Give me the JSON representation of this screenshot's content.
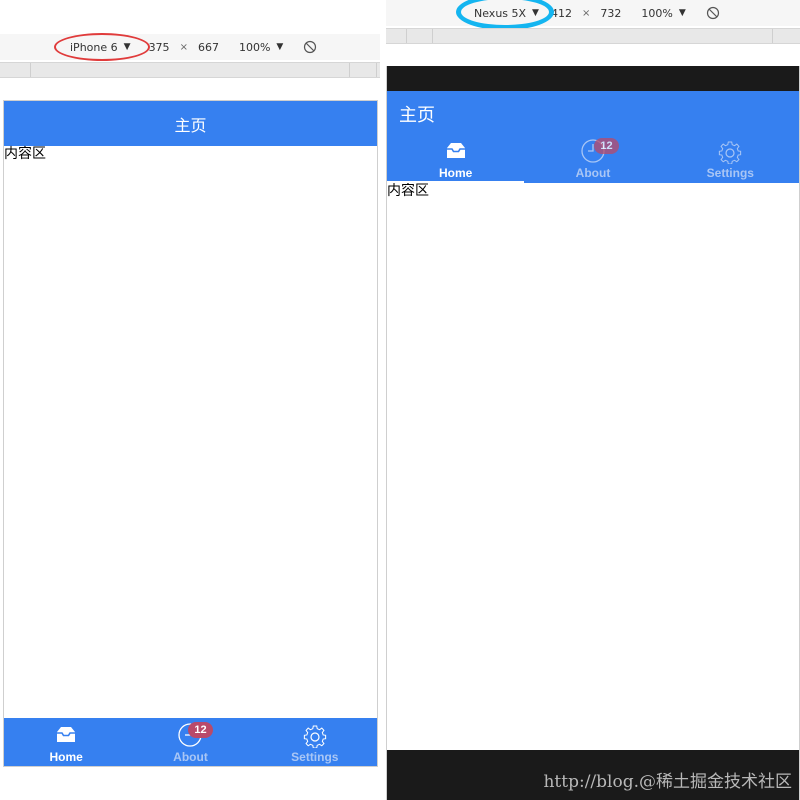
{
  "left_device": {
    "toolbar": {
      "device_name": "iPhone 6",
      "width": "375",
      "times": "×",
      "height": "667",
      "zoom": "100%"
    },
    "header": {
      "title": "主页"
    },
    "content": {
      "text": "内容区"
    },
    "tabs": [
      {
        "label": "Home",
        "icon": "inbox-icon",
        "active": true
      },
      {
        "label": "About",
        "icon": "clock-icon",
        "active": false,
        "badge": "12"
      },
      {
        "label": "Settings",
        "icon": "gear-icon",
        "active": false
      }
    ]
  },
  "right_device": {
    "toolbar": {
      "device_name": "Nexus 5X",
      "width": "412",
      "times": "×",
      "height": "732",
      "zoom": "100%"
    },
    "appbar": {
      "title": "主页"
    },
    "content": {
      "text": "内容区"
    },
    "tabs": [
      {
        "label": "Home",
        "icon": "inbox-icon",
        "active": true
      },
      {
        "label": "About",
        "icon": "clock-icon",
        "active": false,
        "badge": "12"
      },
      {
        "label": "Settings",
        "icon": "gear-icon",
        "active": false
      }
    ]
  },
  "watermark": "http://blog.@稀土掘金技术社区",
  "colors": {
    "primary": "#3680f0",
    "badge": "#b94a6a",
    "system_bar": "#1a1a1a",
    "highlight_left": "#e03b3b",
    "highlight_right": "#14b5f0"
  }
}
